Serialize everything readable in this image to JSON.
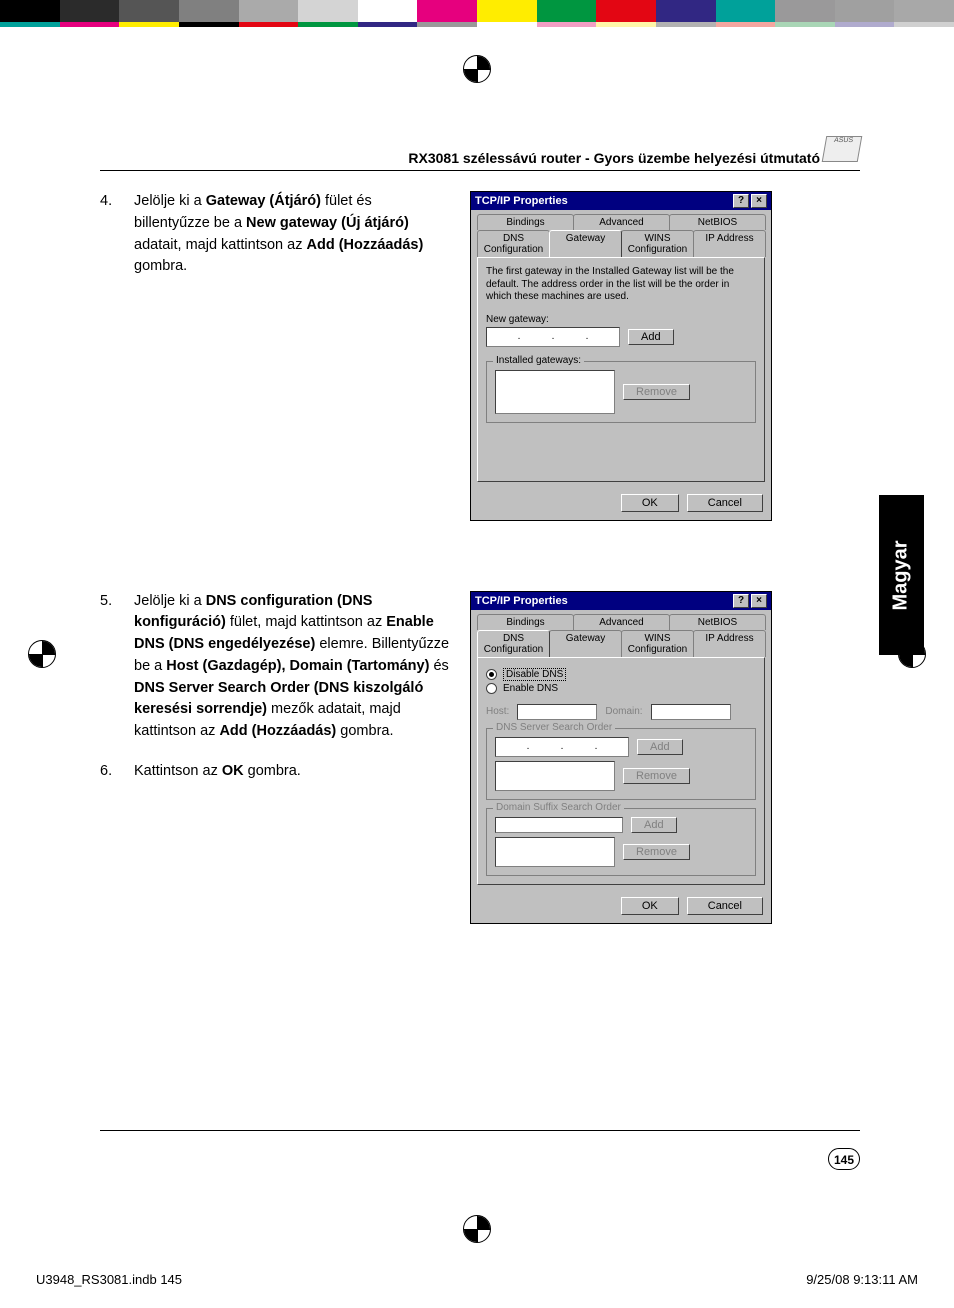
{
  "colorbar1": [
    "#000",
    "#2b2b2b",
    "#555",
    "#808080",
    "#aaa",
    "#d4d4d4",
    "#fff",
    "#e6007e",
    "#ffed00",
    "#009640",
    "#e30613",
    "#312783",
    "#00a19a",
    "#9a999a",
    "#a0a0a0",
    "#a8a8a8"
  ],
  "colorbar2": [
    "#00a19a",
    "#e6007e",
    "#ffed00",
    "#000",
    "#e30613",
    "#009640",
    "#312783",
    "#9a999a",
    "#fff",
    "#f29ec4",
    "#fff6a9",
    "#b2b2b2",
    "#f4a6a0",
    "#a9d6b6",
    "#b0abce",
    "#d0d0d0"
  ],
  "header": {
    "title": "RX3081 szélessávú router - Gyors üzembe helyezési útmutató",
    "icon_text": "ASUS"
  },
  "step4": {
    "num": "4.",
    "t1": "Jelölje ki a ",
    "b1": "Gateway (Átjáró)",
    "t2": " fület és billentyűzze be a ",
    "b2": "New gateway (Új átjáró)",
    "t3": " adatait, majd kattintson az ",
    "b3": "Add (Hozzáadás)",
    "t4": " gombra."
  },
  "step5": {
    "num": "5.",
    "t1": "Jelölje ki a ",
    "b1": "DNS configuration (DNS konfiguráció)",
    "t2": " fület, majd kattintson az ",
    "b2": "Enable DNS (DNS engedélyezése)",
    "t3": " elemre. Billentyűzze be a ",
    "b3": "Host (Gazdagép), Domain (Tartomány)",
    "t4": " és ",
    "b4": "DNS Server Search Order (DNS kiszolgáló keresési sorrendje)",
    "t5": " mezők adatait, majd kattintson az ",
    "b5": "Add (Hozzáadás)",
    "t6": " gombra."
  },
  "step6": {
    "num": "6.",
    "t1": "Kattintson az ",
    "b1": "OK",
    "t2": " gombra."
  },
  "dlg1": {
    "title": "TCP/IP Properties",
    "help": "?",
    "close": "×",
    "tabs_back": [
      "Bindings",
      "Advanced",
      "NetBIOS"
    ],
    "tabs_front": [
      "DNS Configuration",
      "Gateway",
      "WINS Configuration",
      "IP Address"
    ],
    "info": "The first gateway in the Installed Gateway list will be the default. The address order in the list will be the order in which these machines are used.",
    "new_gw_label": "New gateway:",
    "add": "Add",
    "inst_gw_label": "Installed gateways:",
    "remove": "Remove",
    "ok": "OK",
    "cancel": "Cancel"
  },
  "dlg2": {
    "title": "TCP/IP Properties",
    "help": "?",
    "close": "×",
    "tabs_back": [
      "Bindings",
      "Advanced",
      "NetBIOS"
    ],
    "tabs_front": [
      "DNS Configuration",
      "Gateway",
      "WINS Configuration",
      "IP Address"
    ],
    "disable": "Disable DNS",
    "enable": "Enable DNS",
    "host": "Host:",
    "domain": "Domain:",
    "dns_order": "DNS Server Search Order",
    "add": "Add",
    "remove": "Remove",
    "domain_suffix": "Domain Suffix Search Order",
    "add2": "Add",
    "remove2": "Remove",
    "ok": "OK",
    "cancel": "Cancel"
  },
  "lang_tab": "Magyar",
  "page_num": "145",
  "footer": {
    "left": "U3948_RS3081.indb   145",
    "right": "9/25/08   9:13:11 AM"
  }
}
